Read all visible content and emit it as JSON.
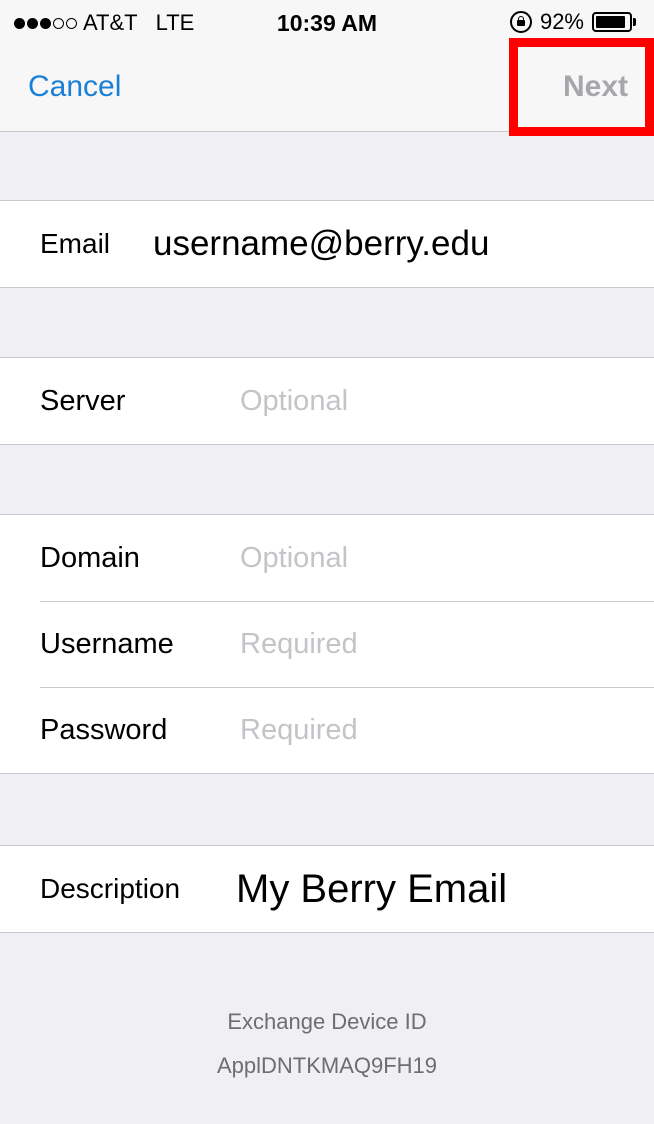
{
  "status_bar": {
    "carrier": "AT&T",
    "network": "LTE",
    "time": "10:39 AM",
    "battery": "92%",
    "battery_level": 0.92,
    "icons": [
      "signal-dots-icon",
      "rotation-lock-icon",
      "battery-icon"
    ]
  },
  "nav": {
    "cancel_label": "Cancel",
    "next_label": "Next",
    "cancel_color": "#1a7fd6",
    "next_disabled_color": "#a7a7ab",
    "highlight_color": "#ff0000"
  },
  "form": {
    "email": {
      "label": "Email",
      "value": "username@berry.edu"
    },
    "server": {
      "label": "Server",
      "placeholder": "Optional"
    },
    "domain": {
      "label": "Domain",
      "placeholder": "Optional"
    },
    "username": {
      "label": "Username",
      "placeholder": "Required"
    },
    "password": {
      "label": "Password",
      "placeholder": "Required"
    },
    "description": {
      "label": "Description",
      "value": "My Berry Email"
    }
  },
  "footer": {
    "title": "Exchange Device ID",
    "device_id": "ApplDNTKMAQ9FH19"
  }
}
